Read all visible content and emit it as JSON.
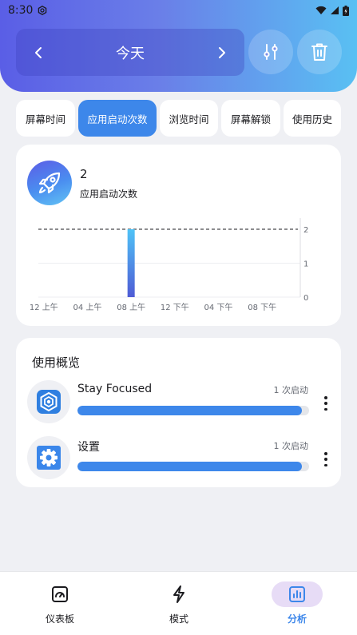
{
  "status_bar": {
    "time": "8:30"
  },
  "header": {
    "date_label": "今天"
  },
  "tabs": [
    {
      "label": "屏幕时间",
      "active": false
    },
    {
      "label": "应用启动次数",
      "active": true
    },
    {
      "label": "浏览时间",
      "active": false
    },
    {
      "label": "屏幕解锁",
      "active": false
    },
    {
      "label": "使用历史",
      "active": false
    }
  ],
  "summary": {
    "value": "2",
    "label": "应用启动次数"
  },
  "chart_data": {
    "type": "bar",
    "x": [
      "12 上午",
      "04 上午",
      "08 上午",
      "12 下午",
      "04 下午",
      "08 下午"
    ],
    "y_ticks": [
      "0",
      "1",
      "2"
    ],
    "ylim": [
      0,
      2
    ],
    "values": [
      0,
      0,
      0,
      0,
      0,
      0,
      0,
      0,
      2,
      0,
      0,
      0,
      0,
      0,
      0,
      0,
      0,
      0,
      0,
      0,
      0,
      0,
      0,
      0
    ],
    "reference_line": 2,
    "grid": true,
    "colors": {
      "bar_top": "#4fc3f7",
      "bar_bottom": "#4f5bd5"
    }
  },
  "usage": {
    "title": "使用概览",
    "apps": [
      {
        "name": "Stay Focused",
        "count": "1 次启动",
        "fraction": 0.97,
        "icon": "stay-focused-app-icon"
      },
      {
        "name": "设置",
        "count": "1 次启动",
        "fraction": 0.97,
        "icon": "settings-gear-icon"
      }
    ]
  },
  "bottom_nav": {
    "dashboard": "仪表板",
    "modes": "模式",
    "analytics": "分析"
  },
  "colors": {
    "accent": "#3d87ea",
    "nav_active_bg": "#e7dcf6"
  }
}
